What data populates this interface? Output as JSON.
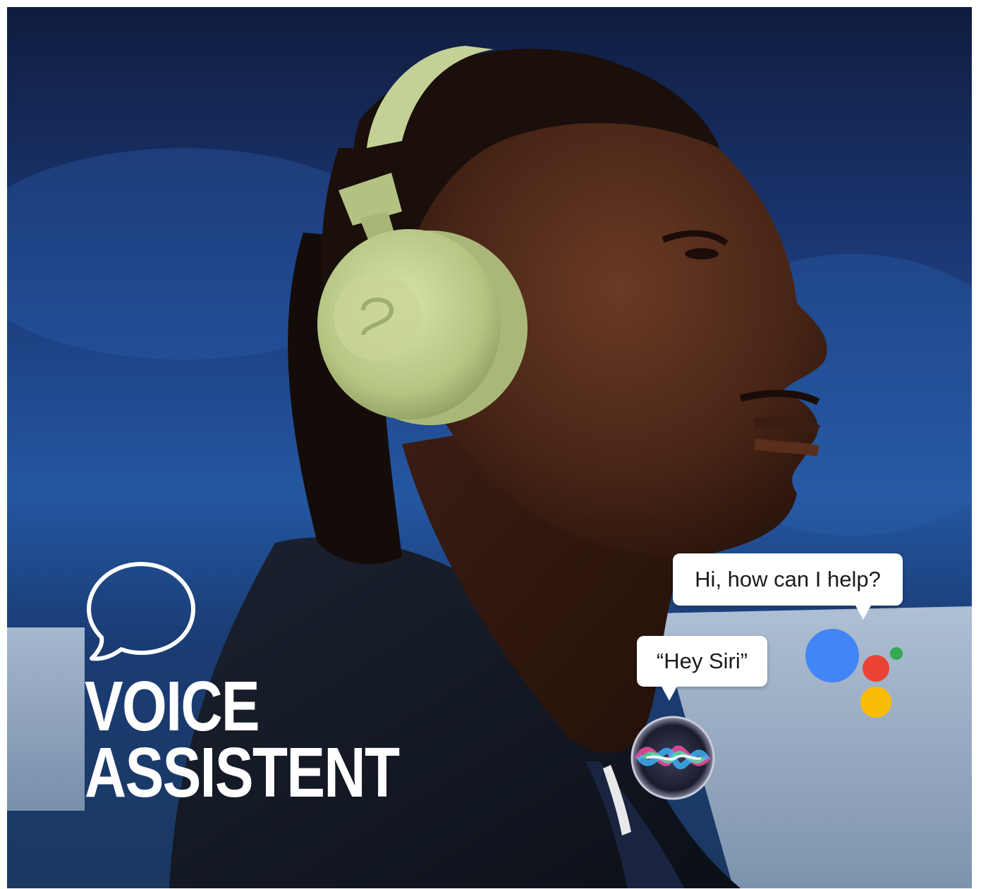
{
  "photo": {
    "subject": "man-with-headphones-icon",
    "background_color": "#1f4a8c",
    "headphone_color": "#b9c98a"
  },
  "headline": {
    "line1": "VOICE",
    "line2": "ASSISTENT"
  },
  "google_assistant": {
    "prompt": "Hi, how can I help?",
    "logo": "google-assistant-icon",
    "colors": {
      "blue": "#4285f4",
      "red": "#ea4335",
      "yellow": "#fbbc05",
      "green": "#34a853"
    }
  },
  "siri": {
    "prompt": "“Hey Siri”",
    "logo": "siri-icon"
  }
}
